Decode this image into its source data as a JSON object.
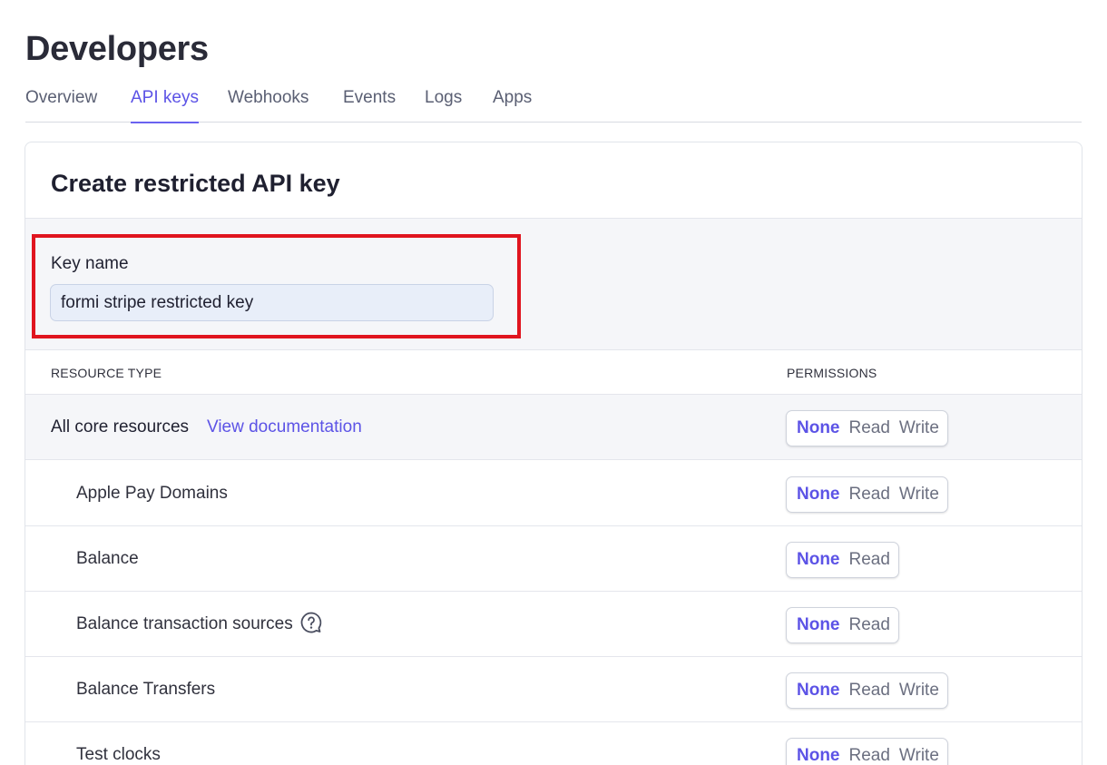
{
  "page": {
    "title": "Developers"
  },
  "tabs": [
    {
      "label": "Overview",
      "active": false
    },
    {
      "label": "API keys",
      "active": true
    },
    {
      "label": "Webhooks",
      "active": false
    },
    {
      "label": "Events",
      "active": false
    },
    {
      "label": "Logs",
      "active": false
    },
    {
      "label": "Apps",
      "active": false
    }
  ],
  "card": {
    "title": "Create restricted API key",
    "key_name_label": "Key name",
    "key_name_value": "formi stripe restricted key"
  },
  "table": {
    "col_resource": "RESOURCE TYPE",
    "col_permissions": "PERMISSIONS",
    "core": {
      "label": "All core resources",
      "doc_link": "View documentation",
      "options": [
        "None",
        "Read",
        "Write"
      ],
      "selected": "None"
    },
    "rows": [
      {
        "label": "Apple Pay Domains",
        "options": [
          "None",
          "Read",
          "Write"
        ],
        "selected": "None",
        "help_icon": false
      },
      {
        "label": "Balance",
        "options": [
          "None",
          "Read"
        ],
        "selected": "None",
        "help_icon": false
      },
      {
        "label": "Balance transaction sources",
        "options": [
          "None",
          "Read"
        ],
        "selected": "None",
        "help_icon": true
      },
      {
        "label": "Balance Transfers",
        "options": [
          "None",
          "Read",
          "Write"
        ],
        "selected": "None",
        "help_icon": false
      },
      {
        "label": "Test clocks",
        "options": [
          "None",
          "Read",
          "Write"
        ],
        "selected": "None",
        "help_icon": false
      }
    ]
  },
  "colors": {
    "accent": "#5c53e6",
    "highlight_border": "#e0151f",
    "input_bg": "#e8eef9",
    "section_bg": "#f5f6f9"
  },
  "icons": {
    "help": "question-bubble-icon"
  }
}
